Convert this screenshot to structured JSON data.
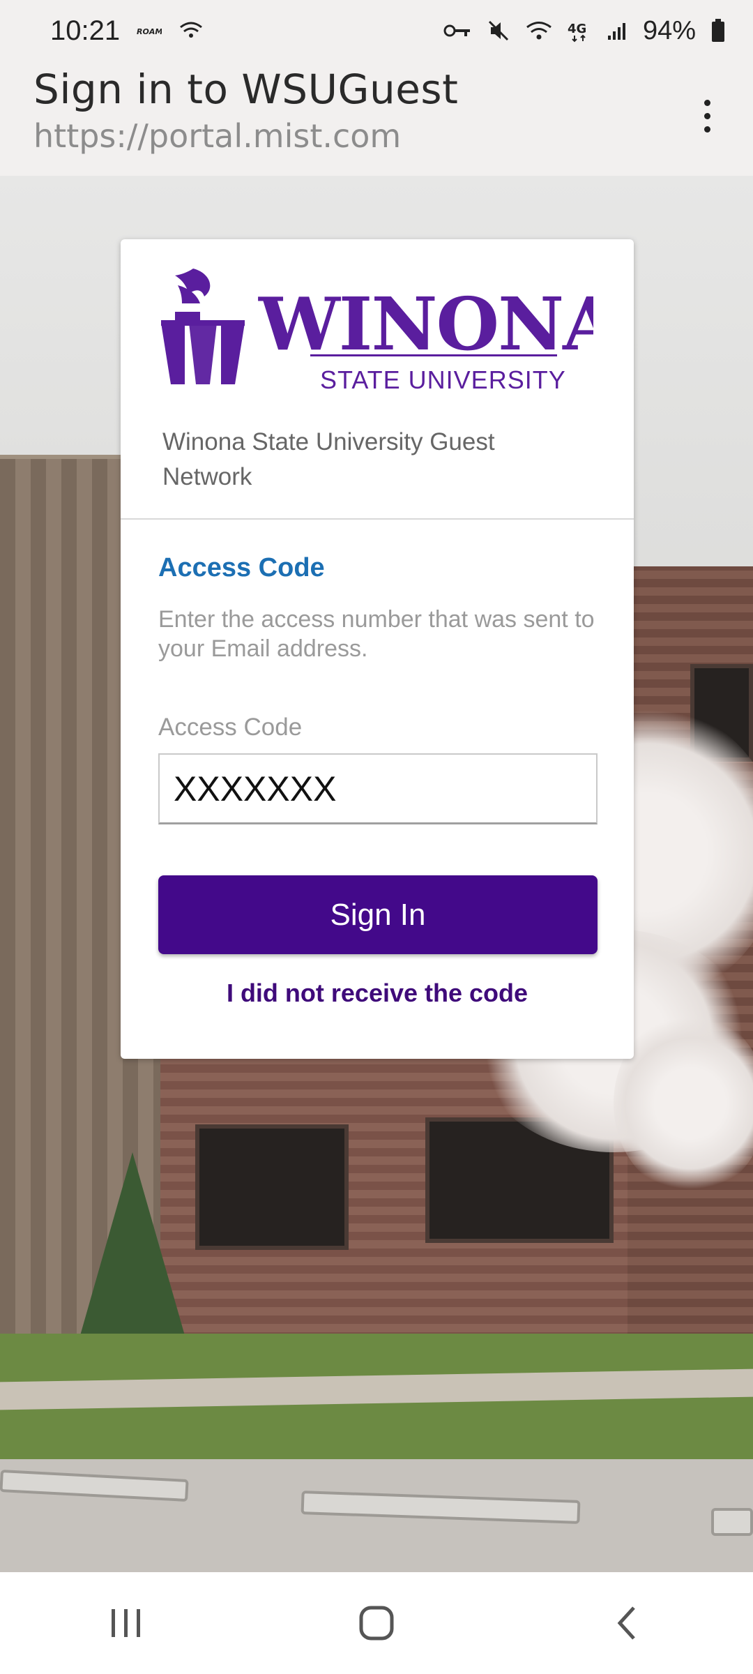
{
  "status_bar": {
    "time": "10:21",
    "battery": "94%",
    "icons": [
      "roaming-icon",
      "wifi-call-icon",
      "key-icon",
      "mute-icon",
      "wifi-icon",
      "4g-icon",
      "signal-icon",
      "battery-icon"
    ]
  },
  "header": {
    "title": "Sign in to WSUGuest",
    "url": "https://portal.mist.com",
    "menu_icon": "more-vert-icon"
  },
  "card": {
    "logo": {
      "wordmark": "WINONA",
      "subtitle": "STATE UNIVERSITY",
      "color": "#5a1e9e"
    },
    "network_name": "Winona State University Guest Network",
    "section_title": "Access Code",
    "help_text": "Enter the access number that was sent to your Email address.",
    "field_label": "Access Code",
    "field_value": "XXXXXXX",
    "signin_label": "Sign In",
    "resend_label": "I did not receive the code"
  },
  "colors": {
    "accent_blue": "#1c6fb3",
    "button_purple": "#43098a",
    "link_purple": "#3f0a7a"
  },
  "nav": {
    "icons": [
      "recent-apps-icon",
      "home-icon",
      "back-icon"
    ]
  }
}
